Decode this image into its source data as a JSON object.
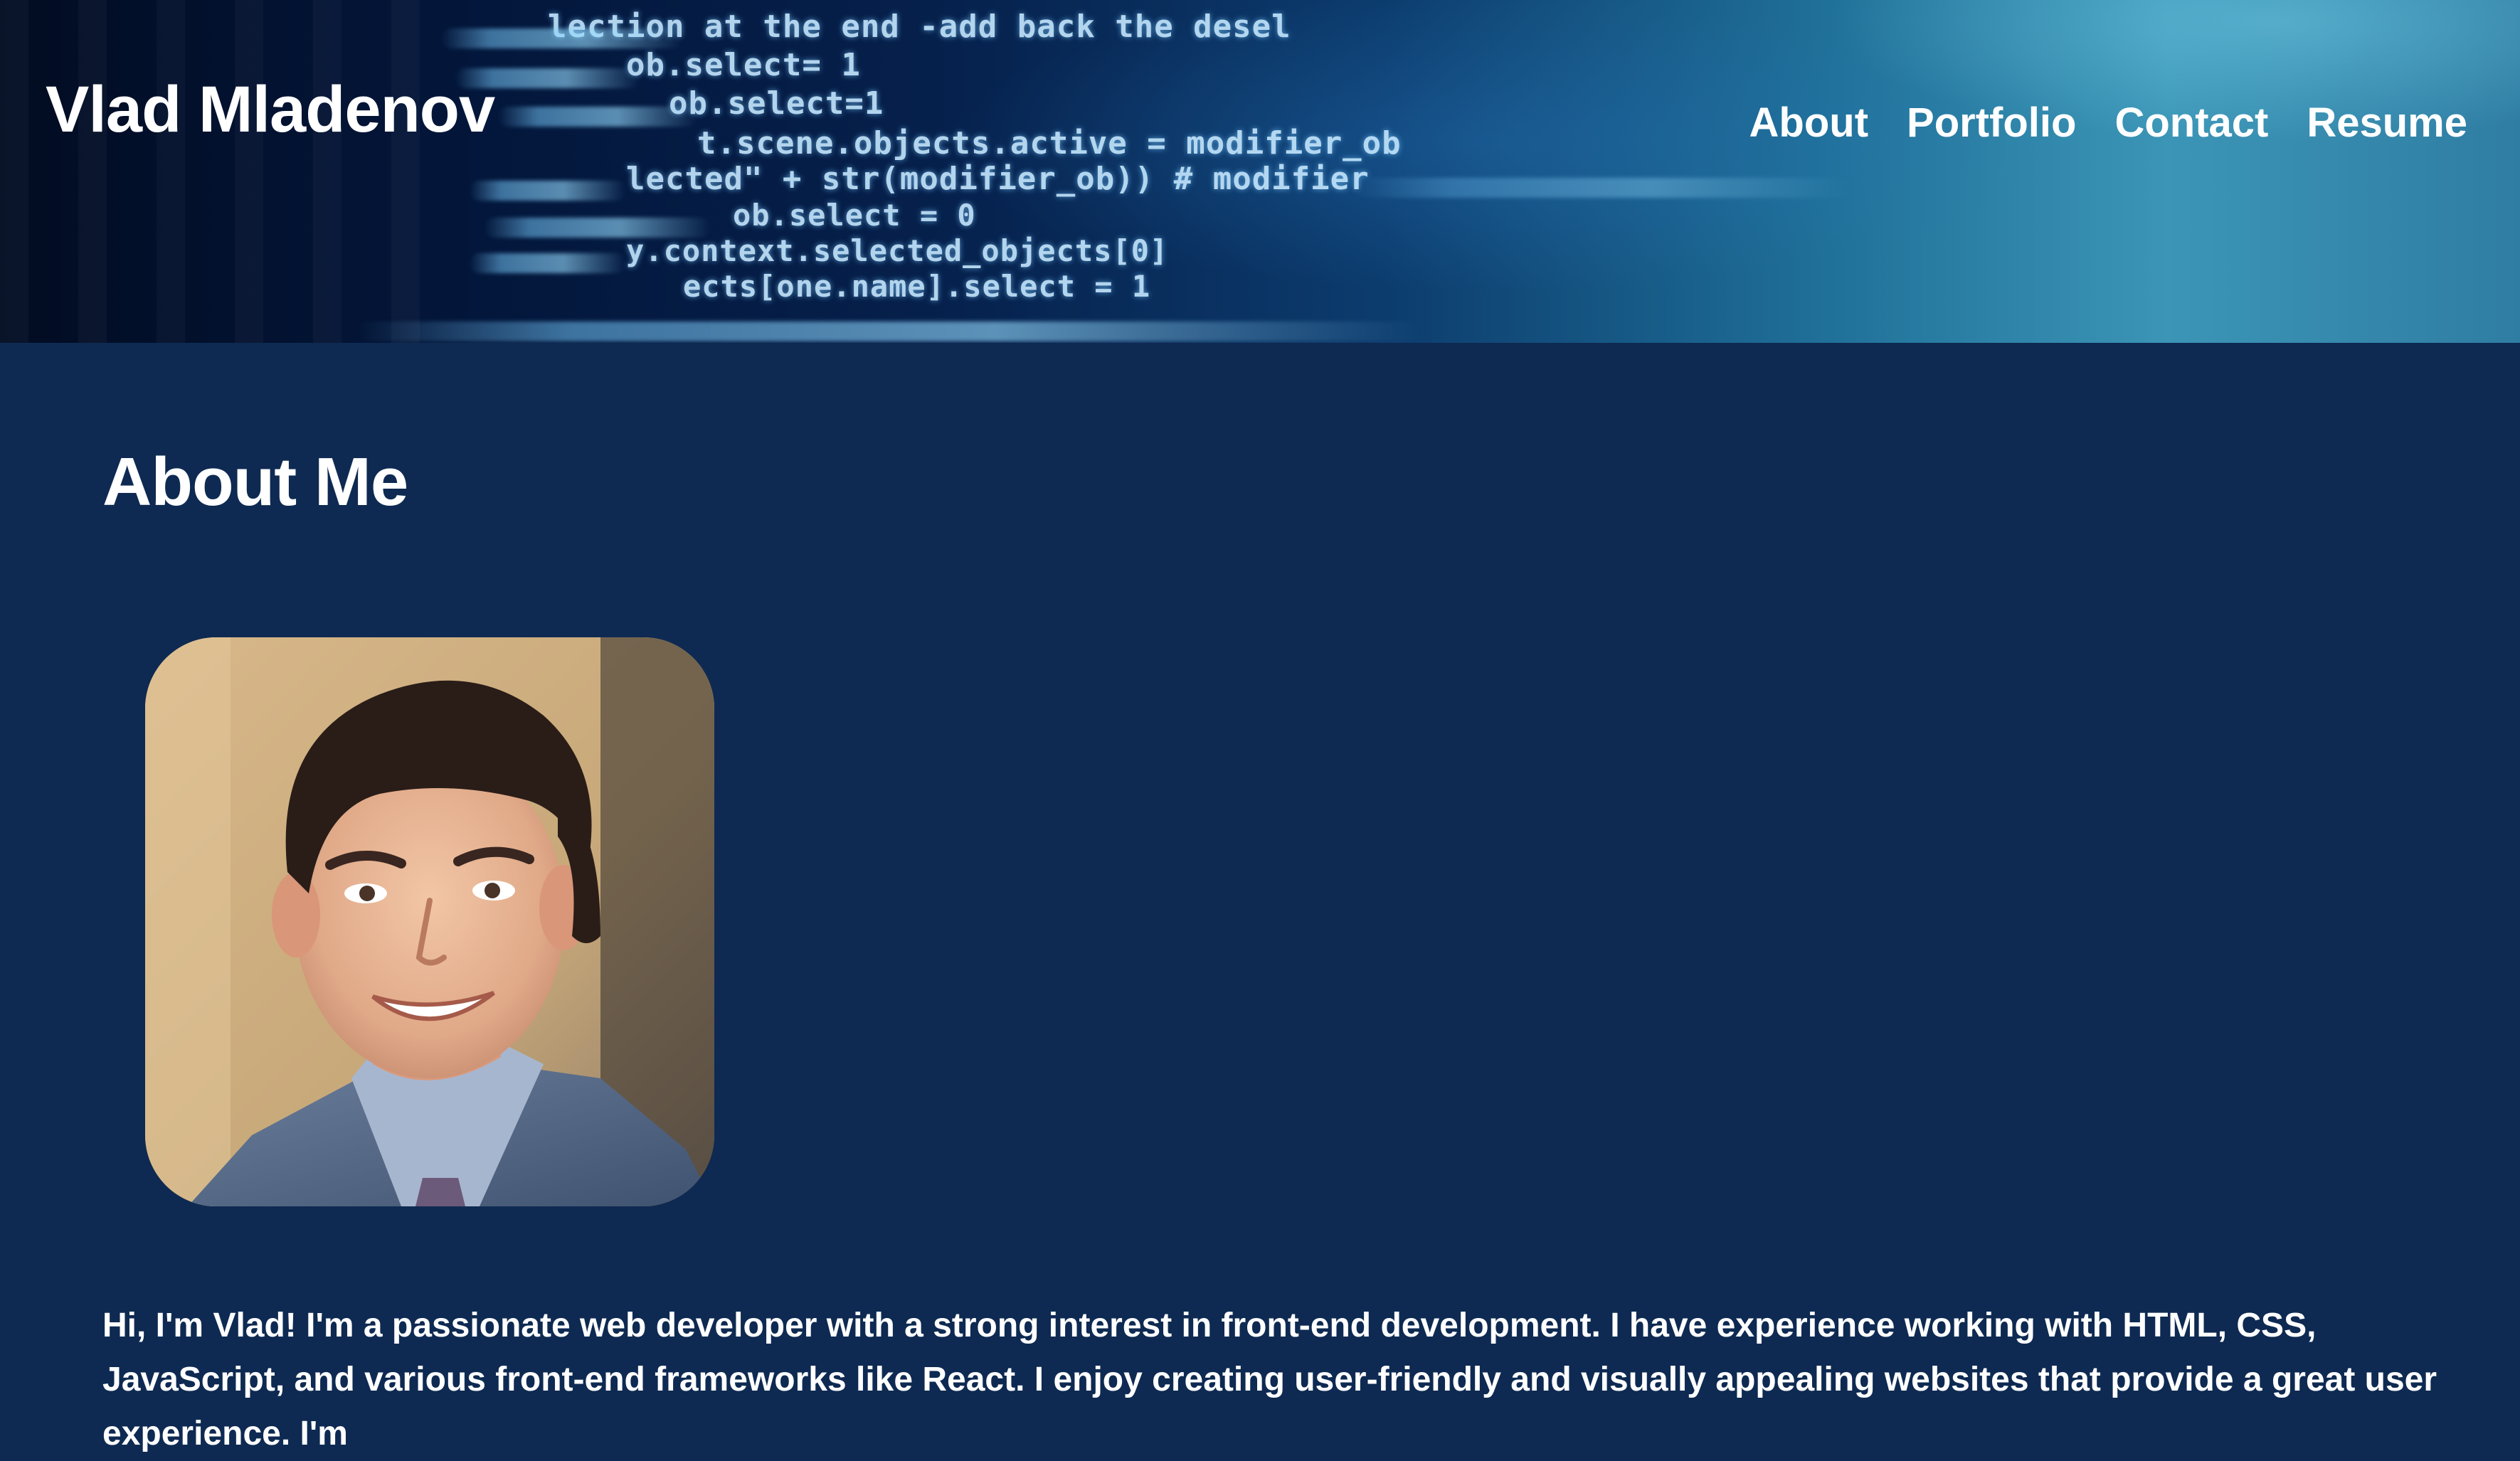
{
  "header": {
    "site_title": "Vlad Mladenov",
    "nav": [
      {
        "label": "About"
      },
      {
        "label": "Portfolio"
      },
      {
        "label": "Contact"
      },
      {
        "label": "Resume"
      }
    ],
    "background_code_lines": [
      "lection at the end -add back the desel",
      "ob.select= 1",
      "ob.select=1",
      "t.scene.objects.active = modifier_ob",
      "lected\" + str(modifier_ob)) # modifier",
      "ob.select = 0",
      "y.context.selected_objects[0]",
      "ects[one.name].select = 1"
    ]
  },
  "about": {
    "heading": "About Me",
    "bio": "Hi, I'm Vlad! I'm a passionate web developer with a strong interest in front-end development. I have experience working with HTML, CSS, JavaScript, and various front-end frameworks like React. I enjoy creating user-friendly and visually appealing websites that provide a great user experience. I'm"
  },
  "colors": {
    "page_background": "#0e2a52",
    "text": "#ffffff",
    "header_dark": "#020c22",
    "header_light": "#3b95b6"
  }
}
